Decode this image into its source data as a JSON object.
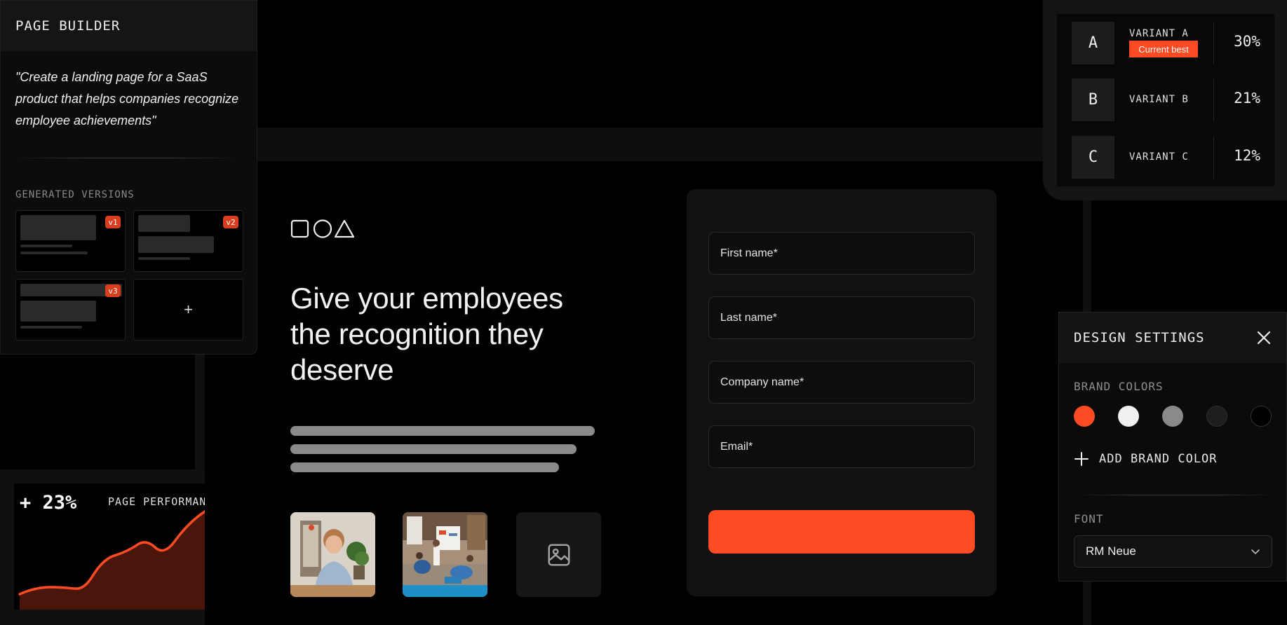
{
  "page_builder": {
    "title": "PAGE BUILDER",
    "prompt": "\"Create a landing page for a SaaS product that helps companies recognize employee achievements\"",
    "versions_label": "GENERATED VERSIONS",
    "versions": [
      {
        "badge": "v1"
      },
      {
        "badge": "v2"
      },
      {
        "badge": "v3"
      }
    ],
    "add_label": "+"
  },
  "variants": [
    {
      "letter": "A",
      "name": "VARIANT A",
      "badge": "Current best",
      "percent": "30%"
    },
    {
      "letter": "B",
      "name": "VARIANT B",
      "percent": "21%"
    },
    {
      "letter": "C",
      "name": "VARIANT C",
      "percent": "12%"
    }
  ],
  "landing": {
    "logo_icon": "shapes-logo-icon",
    "headline": "Give your employees the recognition they deserve",
    "image_placeholder_icon": "image-icon"
  },
  "form": {
    "fields": [
      {
        "label": "First name*"
      },
      {
        "label": "Last name*"
      },
      {
        "label": "Company name*"
      },
      {
        "label": "Email*"
      }
    ],
    "submit_color": "#ff4b23"
  },
  "design_settings": {
    "title": "DESIGN SETTINGS",
    "brand_colors_label": "BRAND COLORS",
    "brand_colors": [
      "#ff4b23",
      "#f0f0f0",
      "#8a8a8a",
      "#1e1e1e",
      "#000000"
    ],
    "add_brand_color": "ADD BRAND COLOR",
    "font_label": "FONT",
    "font_value": "RM Neue"
  },
  "performance": {
    "value": "+ 23%",
    "label": "PAGE PERFORMANCE"
  }
}
